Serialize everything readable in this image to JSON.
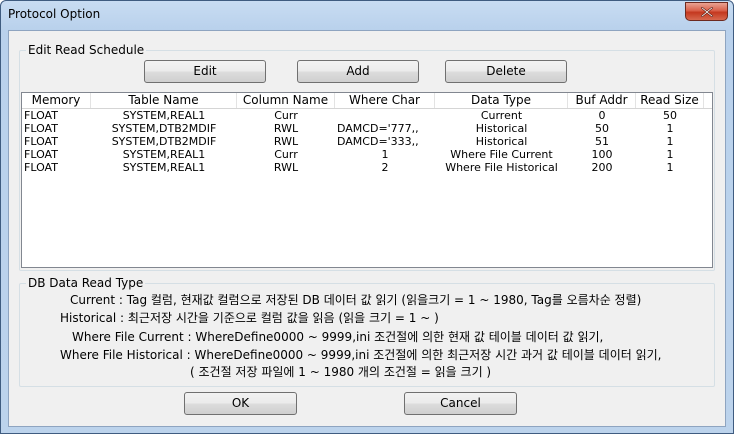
{
  "window": {
    "title": "Protocol Option"
  },
  "schedule_group": {
    "label": "Edit Read Schedule",
    "edit_label": "Edit",
    "add_label": "Add",
    "delete_label": "Delete"
  },
  "table": {
    "headers": [
      "Memory",
      "Table Name",
      "Column Name",
      "Where Char",
      "Data Type",
      "Buf Addr",
      "Read Size"
    ],
    "rows": [
      [
        "FLOAT",
        "SYSTEM,REAL1",
        "Curr",
        "",
        "Current",
        "0",
        "50"
      ],
      [
        "FLOAT",
        "SYSTEM,DTB2MDIF",
        "RWL",
        "DAMCD='777,,",
        "Historical",
        "50",
        "1"
      ],
      [
        "FLOAT",
        "SYSTEM,DTB2MDIF",
        "RWL",
        "DAMCD='333,,",
        "Historical",
        "51",
        "1"
      ],
      [
        "FLOAT",
        "SYSTEM,REAL1",
        "Curr",
        "1",
        "Where File Current",
        "100",
        "1"
      ],
      [
        "FLOAT",
        "SYSTEM,REAL1",
        "RWL",
        "2",
        "Where File Historical",
        "200",
        "1"
      ]
    ]
  },
  "read_type_group": {
    "label": "DB Data Read Type",
    "lines": [
      "Current : Tag 컬럼, 현재값 컬럼으로 저장된 DB 데이터 값 읽기 (읽을크기 = 1 ~ 1980, Tag를 오름차순 정렬)",
      "Historical : 최근저장 시간을 기준으로 컬럼 값을 읽음 (읽을 크기 = 1 ~ )",
      "Where File Current : WhereDefine0000 ~ 9999,ini 조건절에 의한 현재 값 테이블 데이터 값 읽기,",
      "Where File Historical : WhereDefine0000 ~ 9999,ini 조건절에 의한 최근저장 시간 과거 값 테이블 데이터 읽기,",
      "( 조건절 저장 파일에 1 ~ 1980 개의 조건절 = 읽을 크기 )"
    ]
  },
  "footer": {
    "ok_label": "OK",
    "cancel_label": "Cancel"
  },
  "icons": {
    "close": "close-x-icon"
  }
}
